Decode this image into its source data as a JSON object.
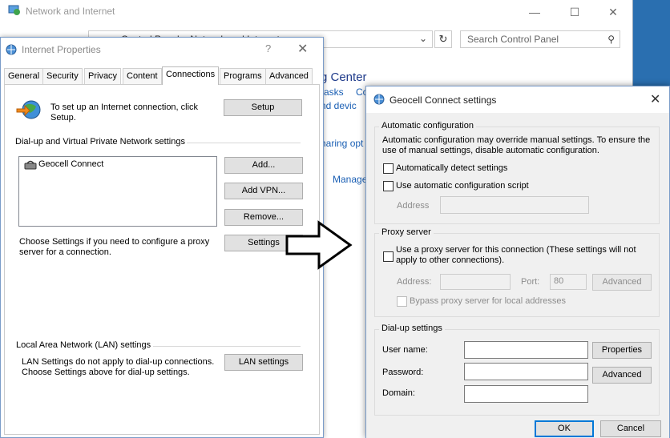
{
  "control_panel": {
    "title": "Network and Internet",
    "breadcrumb": "Control Panel  >  Network and Internet",
    "search_placeholder": "Search Control Panel",
    "heading_fragment": "g Center",
    "link_1": "asks",
    "link_2": "Co",
    "link_3": "nd devic",
    "link_4": "haring opt",
    "link_5": "Manage"
  },
  "internet_properties": {
    "title": "Internet Properties",
    "help": "?",
    "tabs": [
      "General",
      "Security",
      "Privacy",
      "Content",
      "Connections",
      "Programs",
      "Advanced"
    ],
    "active_tab": "Connections",
    "setup_text": "To set up an Internet connection, click Setup.",
    "setup_button": "Setup",
    "dialup_section": "Dial-up and Virtual Private Network settings",
    "connections": [
      {
        "name": "Geocell Connect"
      }
    ],
    "add_button": "Add...",
    "add_vpn_button": "Add VPN...",
    "remove_button": "Remove...",
    "proxy_text": "Choose Settings if you need to configure a proxy server for a connection.",
    "settings_button": "Settings",
    "lan_section": "Local Area Network (LAN) settings",
    "lan_text": "LAN Settings do not apply to dial-up connections. Choose Settings above for dial-up settings.",
    "lan_button": "LAN settings"
  },
  "geocell_dialog": {
    "title": "Geocell Connect settings",
    "auto_config": {
      "legend": "Automatic configuration",
      "description": "Automatic configuration may override manual settings.  To ensure the use of manual settings, disable automatic configuration.",
      "auto_detect_label": "Automatically detect settings",
      "auto_detect_checked": false,
      "script_label": "Use automatic configuration script",
      "script_checked": false,
      "address_label": "Address",
      "address_value": ""
    },
    "proxy": {
      "legend": "Proxy server",
      "use_proxy_label": "Use a proxy server for this connection (These settings will not apply to other connections).",
      "use_proxy_checked": false,
      "address_label": "Address:",
      "address_value": "",
      "port_label": "Port:",
      "port_value": "80",
      "advanced_button": "Advanced",
      "bypass_label": "Bypass proxy server for local addresses",
      "bypass_checked": false
    },
    "dialup": {
      "legend": "Dial-up settings",
      "username_label": "User name:",
      "username_value": "",
      "password_label": "Password:",
      "password_value": "",
      "domain_label": "Domain:",
      "domain_value": "",
      "properties_button": "Properties",
      "advanced_button": "Advanced"
    },
    "ok_button": "OK",
    "cancel_button": "Cancel"
  }
}
